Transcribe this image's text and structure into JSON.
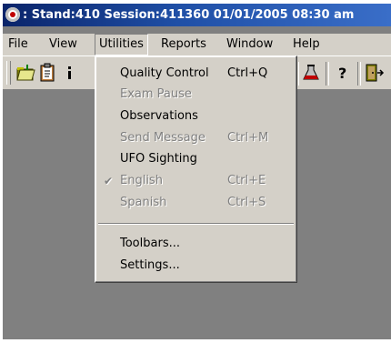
{
  "window": {
    "title": ": Stand:410 Session:411360 01/01/2005 08:30 am"
  },
  "menubar": {
    "items": [
      "File",
      "View",
      "Utilities",
      "Reports",
      "Window",
      "Help"
    ]
  },
  "toolbar": {
    "buttons": [
      "open-folder-icon",
      "clipboard-icon",
      "info-icon",
      "flask-icon",
      "help-icon",
      "exit-door-icon"
    ]
  },
  "dropdown": {
    "items": [
      {
        "label": "Quality Control",
        "shortcut": "Ctrl+Q",
        "enabled": true
      },
      {
        "label": "Exam Pause",
        "shortcut": "",
        "enabled": false
      },
      {
        "label": "Observations",
        "shortcut": "",
        "enabled": true
      },
      {
        "label": "Send Message",
        "shortcut": "Ctrl+M",
        "enabled": false
      },
      {
        "label": "UFO Sighting",
        "shortcut": "",
        "enabled": true
      },
      {
        "label": "English",
        "shortcut": "Ctrl+E",
        "enabled": false,
        "checked": true,
        "check_glyph": "✔"
      },
      {
        "label": "Spanish",
        "shortcut": "Ctrl+S",
        "enabled": false
      }
    ],
    "items_bottom": [
      {
        "label": "Toolbars...",
        "enabled": true
      },
      {
        "label": "Settings...",
        "enabled": true
      }
    ]
  },
  "colors": {
    "titlebar": "#0a246a",
    "face": "#d4d0c8",
    "workspace": "#808080",
    "disabled_text": "#808080"
  }
}
